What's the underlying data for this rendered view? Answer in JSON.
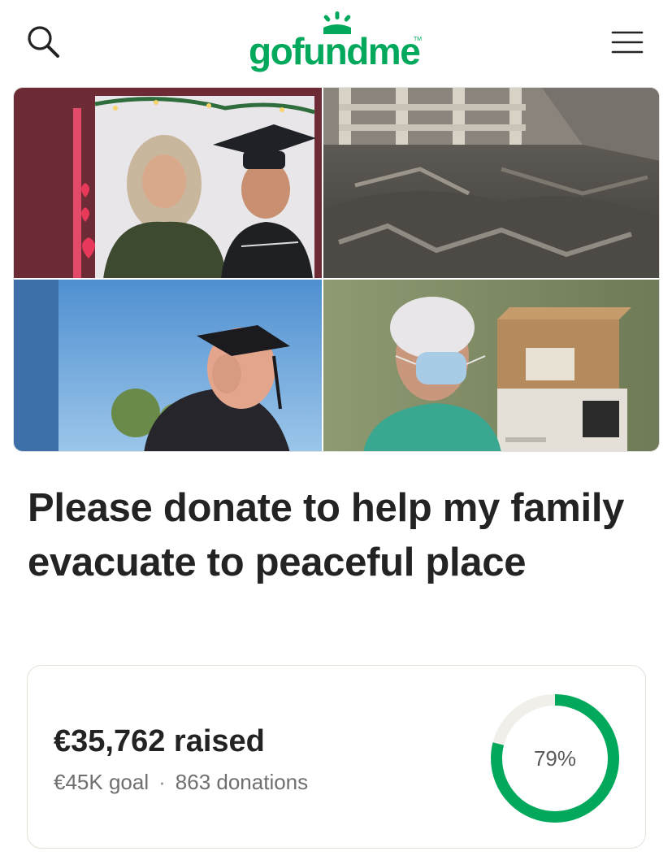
{
  "header": {
    "logo_text": "gofundme",
    "logo_tm": "TM",
    "search_icon": "search-icon",
    "menu_icon": "hamburger-menu-icon",
    "brand_color": "#02a95c"
  },
  "hero": {
    "collage_panels": [
      "family-photo",
      "rubble-photo",
      "graduate-photo",
      "medic-photo"
    ]
  },
  "campaign": {
    "title": "Please donate to help my family evacuate to peaceful place"
  },
  "progress": {
    "raised_text": "€35,762 raised",
    "goal_text": "€45K goal",
    "separator": "·",
    "donations_text": "863 donations",
    "percent_label": "79%",
    "percent_value": 79,
    "ring_color": "#02a95c",
    "track_color": "#f1efe9"
  }
}
